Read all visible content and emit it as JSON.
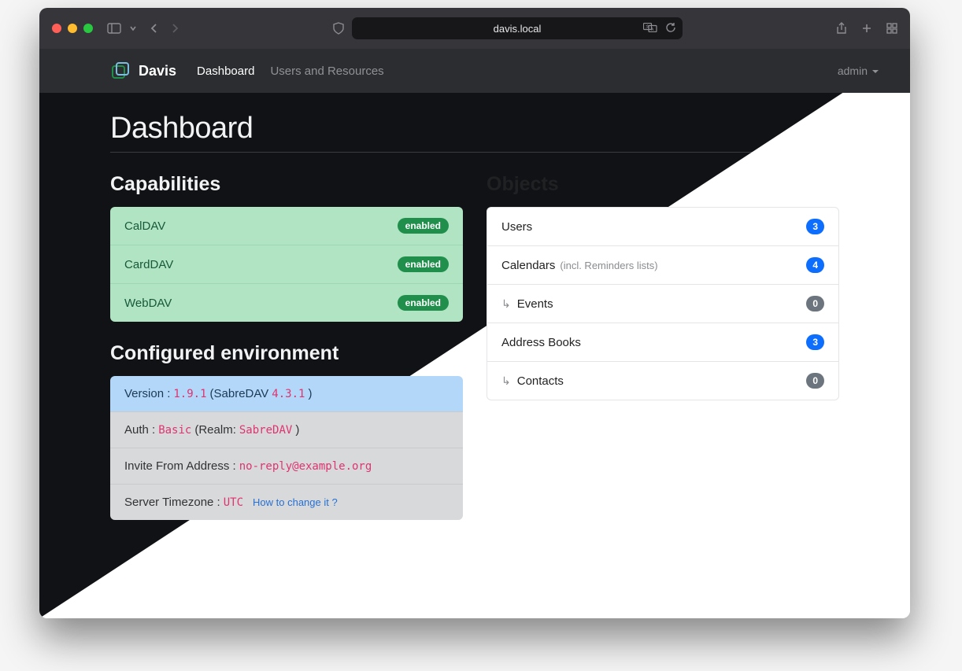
{
  "browser": {
    "address": "davis.local"
  },
  "nav": {
    "brand": "Davis",
    "links": [
      {
        "label": "Dashboard",
        "active": true
      },
      {
        "label": "Users and Resources",
        "active": false
      }
    ],
    "user": "admin"
  },
  "page": {
    "title": "Dashboard"
  },
  "capabilities": {
    "heading": "Capabilities",
    "items": [
      {
        "name": "CalDAV",
        "status": "enabled"
      },
      {
        "name": "CardDAV",
        "status": "enabled"
      },
      {
        "name": "WebDAV",
        "status": "enabled"
      }
    ]
  },
  "environment": {
    "heading": "Configured environment",
    "version_label": "Version :",
    "version_value": "1.9.1",
    "sabredav_prefix": "(SabreDAV",
    "sabredav_value": "4.3.1",
    "sabredav_suffix": ")",
    "auth_label": "Auth :",
    "auth_value": "Basic",
    "auth_realm_prefix": "(Realm:",
    "auth_realm_value": "SabreDAV",
    "auth_realm_suffix": ")",
    "invite_label": "Invite From Address :",
    "invite_value": "no-reply@example.org",
    "tz_label": "Server Timezone :",
    "tz_value": "UTC",
    "tz_help": "How to change it ?"
  },
  "objects": {
    "heading": "Objects",
    "items": [
      {
        "label": "Users",
        "count": 3,
        "color": "blue",
        "indent": false,
        "note": ""
      },
      {
        "label": "Calendars",
        "count": 4,
        "color": "blue",
        "indent": false,
        "note": "(incl. Reminders lists)"
      },
      {
        "label": "Events",
        "count": 0,
        "color": "gray",
        "indent": true,
        "note": ""
      },
      {
        "label": "Address Books",
        "count": 3,
        "color": "blue",
        "indent": false,
        "note": ""
      },
      {
        "label": "Contacts",
        "count": 0,
        "color": "gray",
        "indent": true,
        "note": ""
      }
    ]
  }
}
